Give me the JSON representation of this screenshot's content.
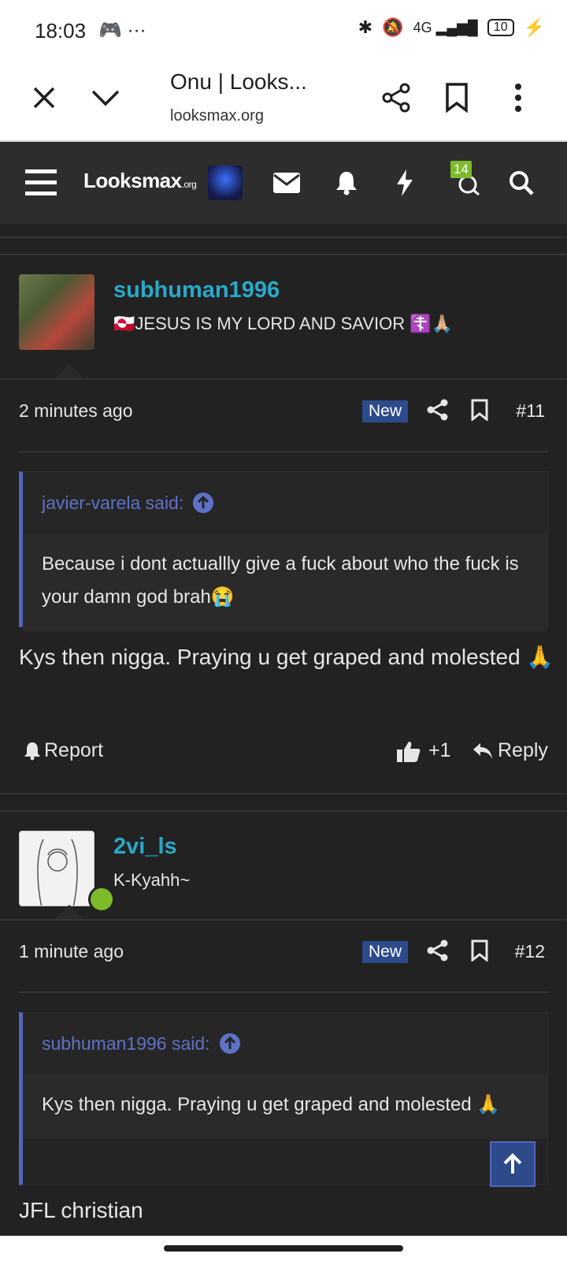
{
  "status_bar": {
    "time": "18:03",
    "battery": "10"
  },
  "browser": {
    "title": "Onu | Looks...",
    "url": "looksmax.org"
  },
  "site_nav": {
    "logo_main": "Looksmax",
    "logo_suffix": ".org",
    "notification_count": "14"
  },
  "posts": [
    {
      "username": "subhuman1996",
      "user_title": "🇬🇱JESUS IS MY LORD AND SAVIOR ☦️🙏🏼",
      "time": "2 minutes ago",
      "new_tag": "New",
      "post_number": "#11",
      "quote_author": "javier-varela said:",
      "quote_text": "Because i dont actuallly give a fuck about who the fuck is your damn god brah😭",
      "body": "Kys then nigga. Praying u get graped and molested 🙏",
      "report_label": "Report",
      "like_count": "+1",
      "reply_label": "Reply"
    },
    {
      "username": "2vi_ls",
      "user_title": "K-Kyahh~",
      "time": "1 minute ago",
      "new_tag": "New",
      "post_number": "#12",
      "quote_author": "subhuman1996 said:",
      "quote_text": "Kys then nigga. Praying u get graped and molested 🙏",
      "body": "JFL christian"
    }
  ],
  "colors": {
    "accent": "#2aa9c9",
    "quote_bar": "#5465bb",
    "new_tag": "#2d4a8b",
    "online": "#7dbb2a",
    "background": "#222222"
  }
}
